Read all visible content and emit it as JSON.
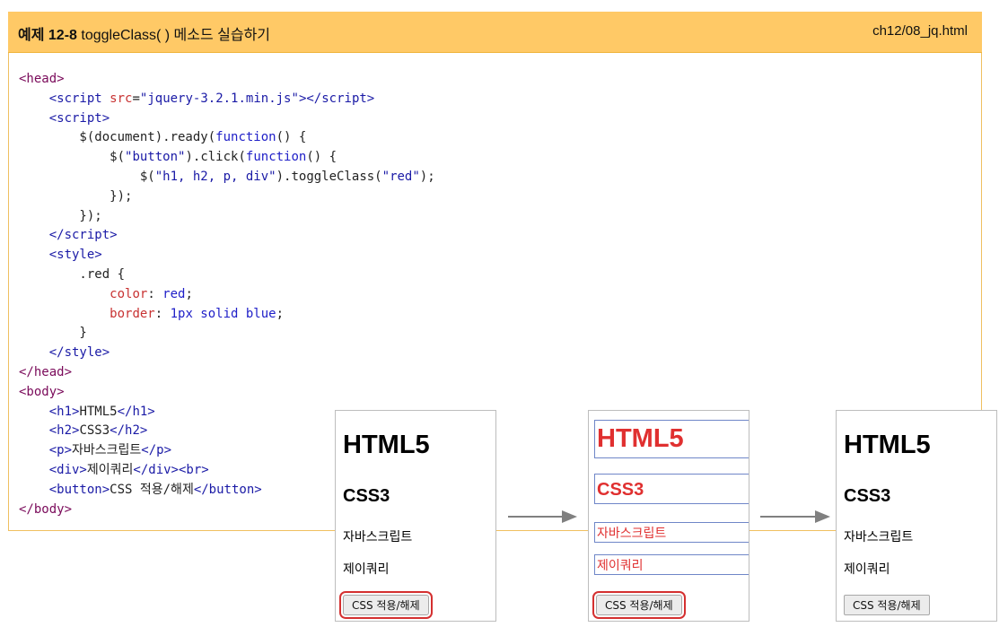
{
  "header": {
    "prefix": "예제",
    "number": "12-8",
    "title": "toggleClass( ) 메소드 실습하기",
    "file": "ch12/08_jq.html"
  },
  "code": {
    "src": "jquery-3.2.1.min.js",
    "button_sel": "button",
    "targets": "h1, h2, p, div",
    "cls": "red",
    "color_prop": "color",
    "color_val": "red",
    "border_prop": "border",
    "border_val": "1px solid blue",
    "h1": "HTML5",
    "h2": "CSS3",
    "p": "자바스크립트",
    "div": "제이쿼리",
    "button": "CSS 적용/해제"
  },
  "previews": [
    {
      "h1": "HTML5",
      "h2": "CSS3",
      "p": "자바스크립트",
      "div": "제이쿼리",
      "button": "CSS 적용/해제"
    },
    {
      "h1": "HTML5",
      "h2": "CSS3",
      "p": "자바스크립트",
      "div": "제이쿼리",
      "button": "CSS 적용/해제"
    },
    {
      "h1": "HTML5",
      "h2": "CSS3",
      "p": "자바스크립트",
      "div": "제이쿼리",
      "button": "CSS 적용/해제"
    }
  ],
  "colors": {
    "header_bg": "#ffc966",
    "red": "#e03030",
    "blue": "#6f86c8",
    "arrow": "#808080"
  }
}
